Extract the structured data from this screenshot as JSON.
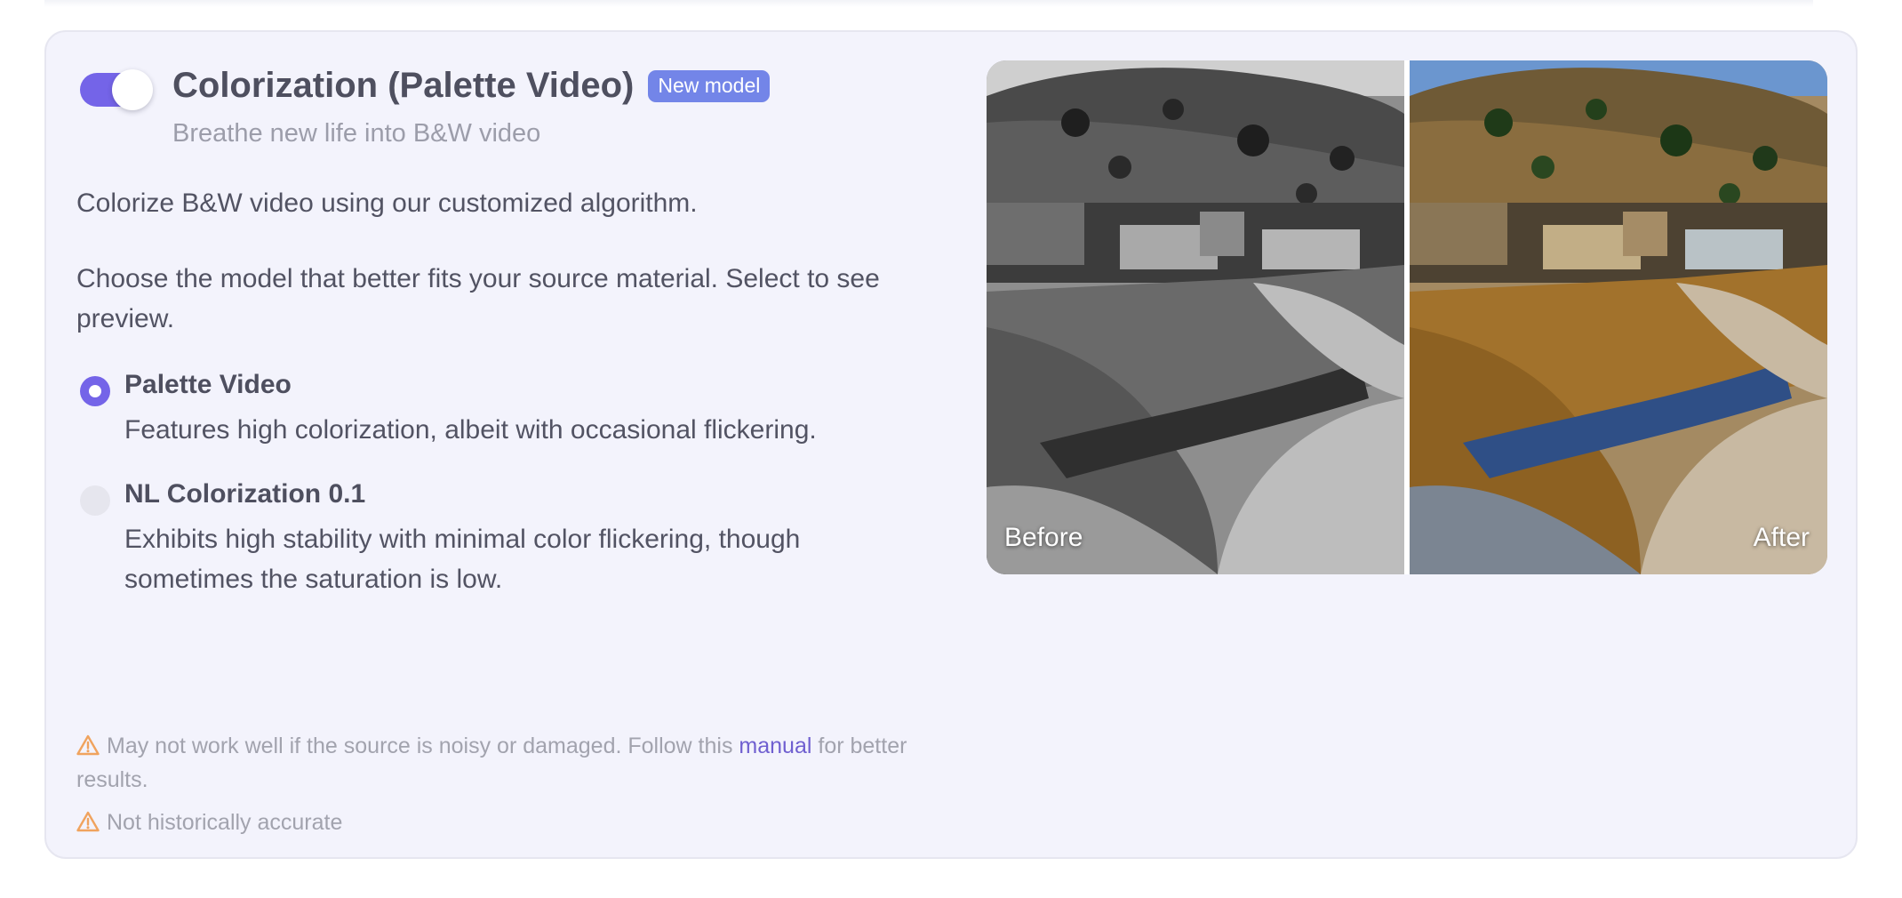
{
  "feature": {
    "enabled": true,
    "title": "Colorization (Palette Video)",
    "badge": "New model",
    "subtitle": "Breathe new life into B&W video"
  },
  "description": {
    "line1": "Colorize B&W video using our customized algorithm.",
    "line2": "Choose the model that better fits your source material. Select to see preview."
  },
  "models": [
    {
      "label": "Palette Video",
      "description": "Features high colorization, albeit with occasional flickering.",
      "selected": true
    },
    {
      "label": "NL Colorization 0.1",
      "description": "Exhibits high stability with minimal color flickering, though sometimes the saturation is low.",
      "selected": false
    }
  ],
  "warnings": {
    "noisy_source": {
      "before_link": "May not work well if the source is noisy or damaged. Follow this",
      "link_text": "manual",
      "after_link": "for better results."
    },
    "historical": "Not historically accurate",
    "icon": "warning-triangle-icon"
  },
  "preview": {
    "before_label": "Before",
    "after_label": "After"
  },
  "colors": {
    "accent": "#7464e8",
    "badge": "#7385e8",
    "link": "#6f5fd0",
    "warning": "#f0a35e",
    "card_background": "#f3f3fc"
  }
}
